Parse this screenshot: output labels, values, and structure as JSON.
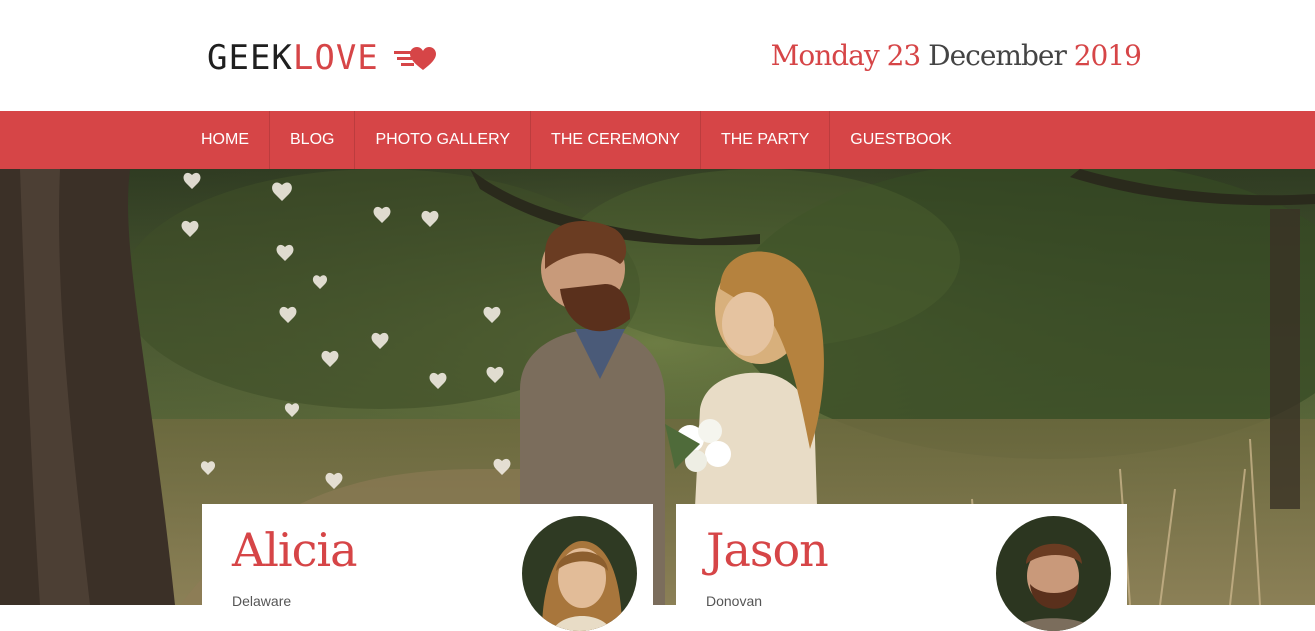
{
  "site": {
    "logo_geek": "GEEK",
    "logo_love": "LOVE",
    "logo_icon": "heart-arrow-icon"
  },
  "date": {
    "day": "Monday",
    "num": "23",
    "month": "December",
    "year": "2019"
  },
  "nav": {
    "items": [
      {
        "label": "HOME"
      },
      {
        "label": "BLOG"
      },
      {
        "label": "PHOTO GALLERY"
      },
      {
        "label": "THE CEREMONY"
      },
      {
        "label": "THE PARTY"
      },
      {
        "label": "GUESTBOOK"
      }
    ]
  },
  "people": [
    {
      "name": "Alicia",
      "subtitle": "Delaware"
    },
    {
      "name": "Jason",
      "subtitle": "Donovan"
    }
  ],
  "colors": {
    "accent": "#d64547",
    "text_dark": "#1f1f1f"
  }
}
